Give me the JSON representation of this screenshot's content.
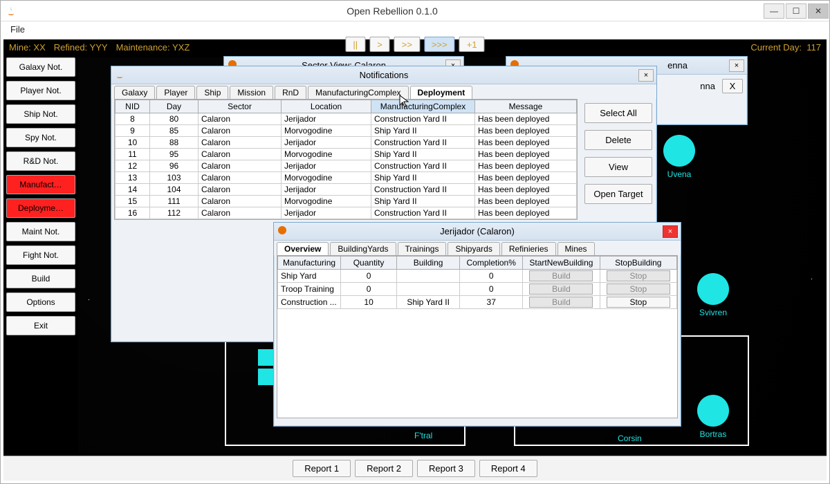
{
  "app": {
    "title": "Open Rebellion 0.1.0",
    "file_menu": "File"
  },
  "status": {
    "mine": "Mine: XX",
    "refined": "Refined: YYY",
    "maint": "Maintenance: YXZ",
    "day_label": "Current Day:",
    "day_value": "117"
  },
  "speed": {
    "pause": "||",
    "play": ">",
    "ff": ">>",
    "fff": ">>>",
    "step": "+1"
  },
  "left_buttons": {
    "galaxy_not": "Galaxy Not.",
    "player_not": "Player Not.",
    "ship_not": "Ship Not.",
    "spy_not": "Spy Not.",
    "rnd_not": "R&D Not.",
    "manufact": "Manufact…",
    "deployme": "Deployme…",
    "maint_not": "Maint Not.",
    "fight_not": "Fight Not.",
    "build": "Build",
    "options": "Options",
    "exit": "Exit"
  },
  "sector_calaron": {
    "title": "Sector View: Calaron",
    "close": "×"
  },
  "sector_enna": {
    "title": "enna",
    "close": "×",
    "label": "nna",
    "x": "X"
  },
  "notifications": {
    "title": "Notifications",
    "close": "×",
    "tabs": {
      "galaxy": "Galaxy",
      "player": "Player",
      "ship": "Ship",
      "mission": "Mission",
      "rnd": "RnD",
      "mc": "ManufacturingComplex",
      "deployment": "Deployment"
    },
    "headers": {
      "nid": "NID",
      "day": "Day",
      "sector": "Sector",
      "location": "Location",
      "mc": "ManufacturingComplex",
      "message": "Message"
    },
    "rows": [
      {
        "nid": "8",
        "day": "80",
        "sector": "Calaron",
        "location": "Jerijador",
        "mc": "Construction Yard II",
        "msg": "Has been deployed"
      },
      {
        "nid": "9",
        "day": "85",
        "sector": "Calaron",
        "location": "Morvogodine",
        "mc": "Ship Yard II",
        "msg": "Has been deployed"
      },
      {
        "nid": "10",
        "day": "88",
        "sector": "Calaron",
        "location": "Jerijador",
        "mc": "Construction Yard II",
        "msg": "Has been deployed"
      },
      {
        "nid": "11",
        "day": "95",
        "sector": "Calaron",
        "location": "Morvogodine",
        "mc": "Ship Yard II",
        "msg": "Has been deployed"
      },
      {
        "nid": "12",
        "day": "96",
        "sector": "Calaron",
        "location": "Jerijador",
        "mc": "Construction Yard II",
        "msg": "Has been deployed"
      },
      {
        "nid": "13",
        "day": "103",
        "sector": "Calaron",
        "location": "Morvogodine",
        "mc": "Ship Yard II",
        "msg": "Has been deployed"
      },
      {
        "nid": "14",
        "day": "104",
        "sector": "Calaron",
        "location": "Jerijador",
        "mc": "Construction Yard II",
        "msg": "Has been deployed"
      },
      {
        "nid": "15",
        "day": "111",
        "sector": "Calaron",
        "location": "Morvogodine",
        "mc": "Ship Yard II",
        "msg": "Has been deployed"
      },
      {
        "nid": "16",
        "day": "112",
        "sector": "Calaron",
        "location": "Jerijador",
        "mc": "Construction Yard II",
        "msg": "Has been deployed"
      }
    ],
    "side": {
      "select_all": "Select All",
      "delete": "Delete",
      "view": "View",
      "open_target": "Open Target"
    }
  },
  "planet": {
    "title": "Jerijador (Calaron)",
    "close": "×",
    "tabs": {
      "overview": "Overview",
      "building_yards": "BuildingYards",
      "trainings": "Trainings",
      "shipyards": "Shipyards",
      "refineries": "Refinieries",
      "mines": "Mines"
    },
    "headers": {
      "manufacturing": "Manufacturing",
      "quantity": "Quantity",
      "building": "Building",
      "completion": "Completion%",
      "start": "StartNewBuilding",
      "stop": "StopBuilding"
    },
    "rows": [
      {
        "m": "Ship Yard",
        "q": "0",
        "b": "",
        "c": "0",
        "start": "Build",
        "stop": "Stop"
      },
      {
        "m": "Troop Training",
        "q": "0",
        "b": "",
        "c": "0",
        "start": "Build",
        "stop": "Stop"
      },
      {
        "m": "Construction ...",
        "q": "10",
        "b": "Ship Yard II",
        "c": "37",
        "start": "Build",
        "stop": "Stop"
      }
    ]
  },
  "planets": {
    "uvena": "Uvena",
    "svivren": "Svivren",
    "bortras": "Bortras",
    "corsin": "Corsin",
    "ftral": "F'tral"
  },
  "reports": {
    "r1": "Report 1",
    "r2": "Report 2",
    "r3": "Report 3",
    "r4": "Report 4"
  }
}
